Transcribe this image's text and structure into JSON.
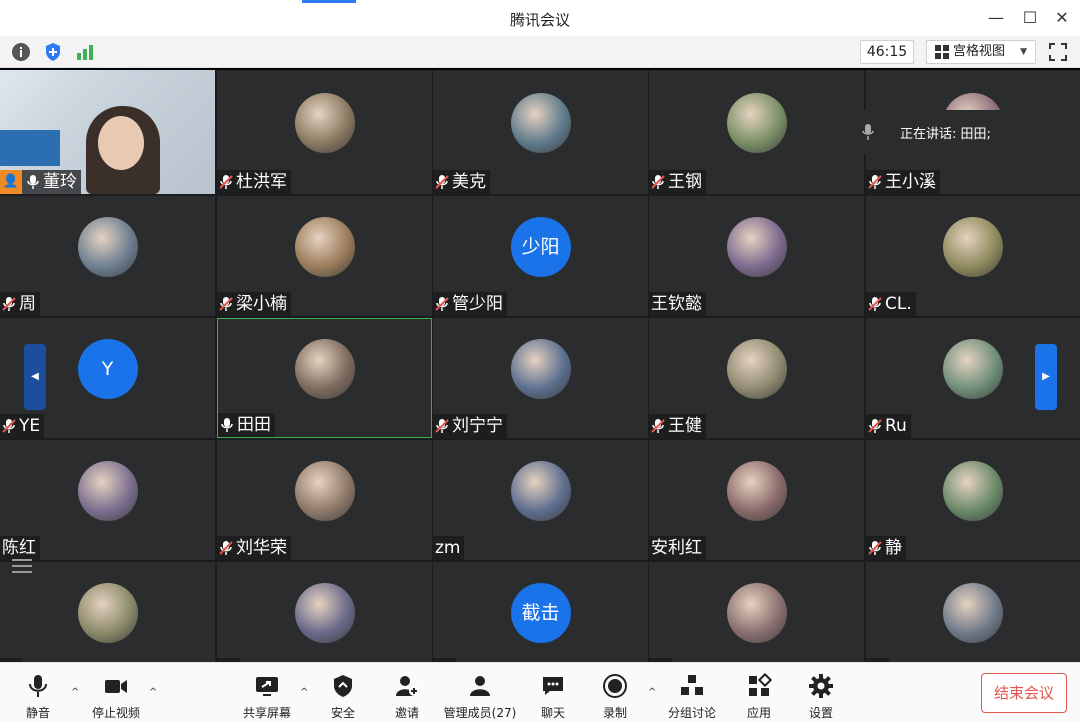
{
  "window": {
    "title": "腾讯会议"
  },
  "toolbar": {
    "timer": "46:15",
    "view_label": "宫格视图"
  },
  "speaking": {
    "text": "正在讲话: 田田;"
  },
  "participants": [
    {
      "name": "董玲",
      "muted": false,
      "host": true
    },
    {
      "name": "杜洪军",
      "muted": true
    },
    {
      "name": "美克",
      "muted": true
    },
    {
      "name": "王钢",
      "muted": true
    },
    {
      "name": "王小溪",
      "muted": true
    },
    {
      "name": "周",
      "muted": true
    },
    {
      "name": "梁小楠",
      "muted": true
    },
    {
      "name": "管少阳",
      "muted": true,
      "avatar_text": "少阳"
    },
    {
      "name": "王钦懿",
      "muted": null
    },
    {
      "name": "CL.",
      "muted": true
    },
    {
      "name": "YE",
      "muted": true,
      "avatar_text": "Y"
    },
    {
      "name": "田田",
      "muted": false,
      "active": true
    },
    {
      "name": "刘宁宁",
      "muted": true
    },
    {
      "name": "王健",
      "muted": true
    },
    {
      "name": "Ru",
      "muted": true
    },
    {
      "name": "陈红",
      "muted": null
    },
    {
      "name": "刘华荣",
      "muted": true
    },
    {
      "name": "zm",
      "muted": null
    },
    {
      "name": "安利红",
      "muted": null
    },
    {
      "name": "静",
      "muted": true
    },
    {
      "name": "",
      "muted": true
    },
    {
      "name": "",
      "muted": true
    },
    {
      "name": "",
      "muted": true,
      "avatar_text": "截击"
    },
    {
      "name": "",
      "muted": true
    },
    {
      "name": "",
      "muted": true
    }
  ],
  "bottombar": {
    "mute": "静音",
    "video": "停止视频",
    "share": "共享屏幕",
    "security": "安全",
    "invite": "邀请",
    "members": "管理成员(27)",
    "chat": "聊天",
    "record": "录制",
    "breakout": "分组讨论",
    "apps": "应用",
    "settings": "设置",
    "end": "结束会议"
  },
  "colors": {
    "accent": "#1a73e8",
    "end_red": "#e3554f",
    "active_border": "#3fae55"
  }
}
